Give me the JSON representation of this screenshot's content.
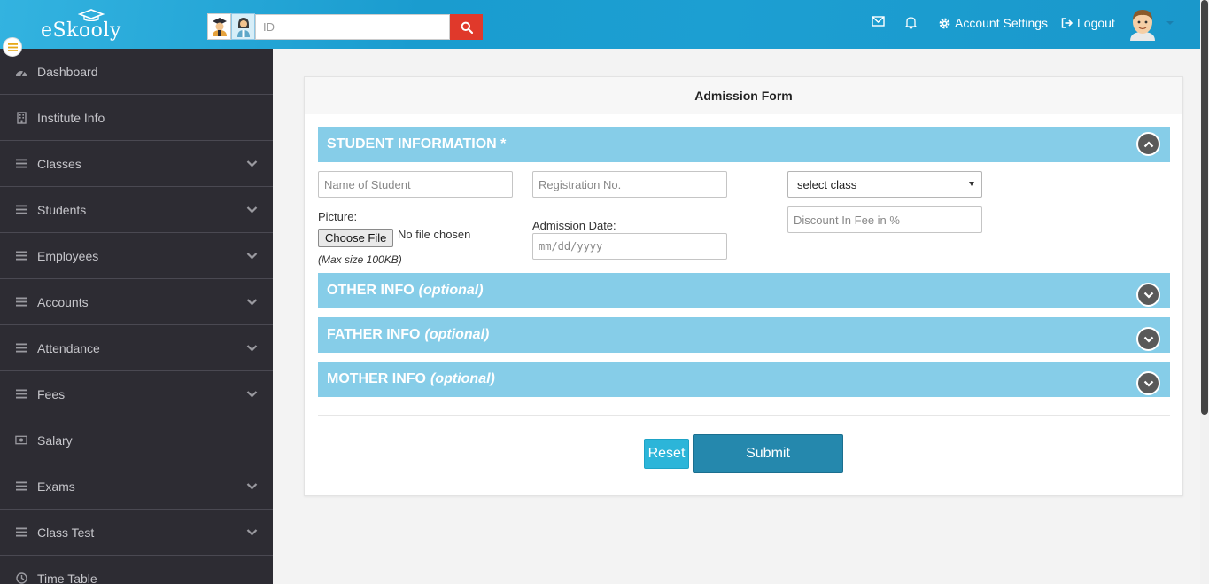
{
  "header": {
    "logo_text": "eSkooly",
    "search": {
      "placeholder": "ID",
      "value": ""
    },
    "icons": {
      "mail": "envelope-icon",
      "notifications": "bell-icon",
      "settings": "gear-icon",
      "logout": "sign-out-icon"
    },
    "account_settings_label": "Account Settings",
    "logout_label": "Logout"
  },
  "sidebar": {
    "items": [
      {
        "label": "Dashboard",
        "icon": "dashboard-icon",
        "has_submenu": false
      },
      {
        "label": "Institute Info",
        "icon": "building-icon",
        "has_submenu": false
      },
      {
        "label": "Classes",
        "icon": "bars-icon",
        "has_submenu": true
      },
      {
        "label": "Students",
        "icon": "bars-icon",
        "has_submenu": true
      },
      {
        "label": "Employees",
        "icon": "bars-icon",
        "has_submenu": true
      },
      {
        "label": "Accounts",
        "icon": "bars-icon",
        "has_submenu": true
      },
      {
        "label": "Attendance",
        "icon": "bars-icon",
        "has_submenu": true
      },
      {
        "label": "Fees",
        "icon": "bars-icon",
        "has_submenu": true
      },
      {
        "label": "Salary",
        "icon": "money-icon",
        "has_submenu": false
      },
      {
        "label": "Exams",
        "icon": "bars-icon",
        "has_submenu": true
      },
      {
        "label": "Class Test",
        "icon": "bars-icon",
        "has_submenu": true
      },
      {
        "label": "Time Table",
        "icon": "clock-icon",
        "has_submenu": false
      }
    ]
  },
  "form": {
    "title": "Admission Form",
    "sections": {
      "student": {
        "title": "STUDENT INFORMATION *",
        "expanded": true
      },
      "other": {
        "title": "OTHER INFO",
        "optional": "(optional)"
      },
      "father": {
        "title": "FATHER INFO",
        "optional": "(optional)"
      },
      "mother": {
        "title": "MOTHER INFO",
        "optional": "(optional)"
      }
    },
    "fields": {
      "name_placeholder": "Name of Student",
      "registration_placeholder": "Registration No.",
      "class_select": "select class",
      "discount_placeholder": "Discount In Fee in %",
      "picture_label": "Picture:",
      "choose_file": "Choose File",
      "no_file": "No file chosen",
      "max_size": "(Max size 100KB)",
      "admission_date_label": "Admission Date:",
      "admission_date_placeholder": "mm/dd/yyyy"
    },
    "buttons": {
      "reset": "Reset",
      "submit": "Submit"
    }
  },
  "colors": {
    "topbar": "#1c9fd2",
    "sidebar": "#2d2c33",
    "section_bar": "#86cde8",
    "search_button": "#e0392b",
    "reset": "#2cb5d9",
    "submit": "#2588ad"
  }
}
